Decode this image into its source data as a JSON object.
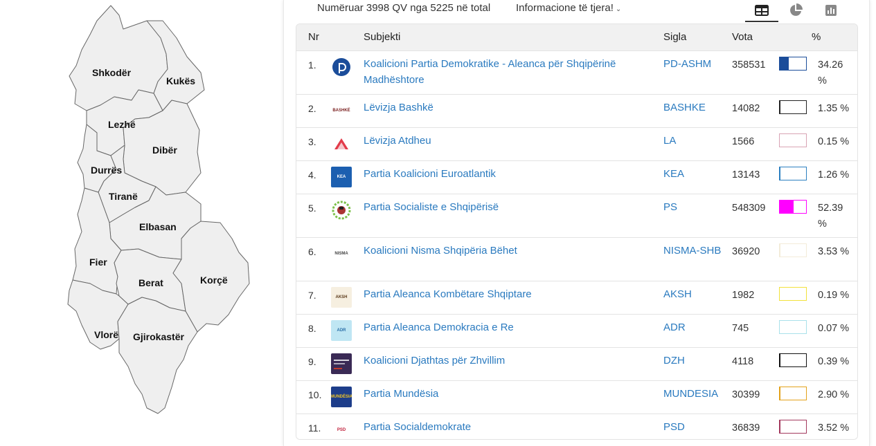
{
  "map": {
    "regions": [
      {
        "id": "shkoder",
        "label": "Shkodër"
      },
      {
        "id": "kukes",
        "label": "Kukës"
      },
      {
        "id": "lezhe",
        "label": "Lezhë"
      },
      {
        "id": "diber",
        "label": "Dibër"
      },
      {
        "id": "durres",
        "label": "Durrës"
      },
      {
        "id": "tirane",
        "label": "Tiranë"
      },
      {
        "id": "elbasan",
        "label": "Elbasan"
      },
      {
        "id": "fier",
        "label": "Fier"
      },
      {
        "id": "berat",
        "label": "Berat"
      },
      {
        "id": "korce",
        "label": "Korçë"
      },
      {
        "id": "vlore",
        "label": "Vlorë"
      },
      {
        "id": "gjirokaster",
        "label": "Gjirokastër"
      }
    ]
  },
  "header": {
    "counted_text": "Numëruar 3998 QV nga 5225 në total",
    "more_info_label": "Informacione të tjera!",
    "view_tabs": [
      {
        "icon": "table-icon",
        "active": true
      },
      {
        "icon": "pie-chart-icon",
        "active": false
      },
      {
        "icon": "bar-chart-icon",
        "active": false
      }
    ]
  },
  "table": {
    "columns": {
      "nr": "Nr",
      "subject": "Subjekti",
      "sigla": "Sigla",
      "votes": "Vota",
      "percent": "%"
    },
    "rows": [
      {
        "nr": "1.",
        "name": "Koalicioni Partia Demokratike - Aleanca për Shqipërinë Madhështore",
        "sigla": "PD-ASHM",
        "votes": "358531",
        "percent": "34.26 %",
        "share": 34.26,
        "color": "#1b4d9a",
        "logo": "pd-logo-icon"
      },
      {
        "nr": "2.",
        "name": "Lëvizja Bashkë",
        "sigla": "BASHKE",
        "votes": "14082",
        "percent": "1.35 %",
        "share": 1.35,
        "color": "#222222",
        "logo": "bashke-logo-icon",
        "logo_text": "BASHKË"
      },
      {
        "nr": "3.",
        "name": "Lëvizja Atdheu",
        "sigla": "LA",
        "votes": "1566",
        "percent": "0.15 %",
        "share": 0.15,
        "color": "#d9a3b4",
        "logo": "la-logo-icon"
      },
      {
        "nr": "4.",
        "name": "Partia Koalicioni Euroatlantik",
        "sigla": "KEA",
        "votes": "13143",
        "percent": "1.26 %",
        "share": 1.26,
        "color": "#2b7fc0",
        "logo": "kea-logo-icon",
        "logo_text": "KEA"
      },
      {
        "nr": "5.",
        "name": "Partia Socialiste e Shqipërisë",
        "sigla": "PS",
        "votes": "548309",
        "percent": "52.39 %",
        "share": 52.39,
        "color": "#ff00ff",
        "logo": "ps-logo-icon"
      },
      {
        "nr": "6.",
        "name": "Koalicioni Nisma Shqipëria Bëhet",
        "sigla": "NISMA-SHB",
        "votes": "36920",
        "percent": "3.53 %",
        "share": 3.53,
        "color": "#f3ecd9",
        "logo": "nisma-logo-icon",
        "logo_text": "NISMA"
      },
      {
        "nr": "7.",
        "name": "Partia Aleanca Kombëtare Shqiptare",
        "sigla": "AKSH",
        "votes": "1982",
        "percent": "0.19 %",
        "share": 0.19,
        "color": "#f2e13a",
        "logo": "aksh-logo-icon",
        "logo_text": "AKSH"
      },
      {
        "nr": "8.",
        "name": "Partia Aleanca Demokracia e Re",
        "sigla": "ADR",
        "votes": "745",
        "percent": "0.07 %",
        "share": 0.07,
        "color": "#a9e1ea",
        "logo": "adr-logo-icon",
        "logo_text": "ADR"
      },
      {
        "nr": "9.",
        "name": "Koalicioni Djathtas për Zhvillim",
        "sigla": "DZH",
        "votes": "4118",
        "percent": "0.39 %",
        "share": 0.39,
        "color": "#111111",
        "logo": "dzh-logo-icon"
      },
      {
        "nr": "10.",
        "name": "Partia Mundësia",
        "sigla": "MUNDESIA",
        "votes": "30399",
        "percent": "2.90 %",
        "share": 2.9,
        "color": "#e3a21a",
        "logo": "mundesia-logo-icon",
        "logo_text": "MUNDËSIA"
      },
      {
        "nr": "11.",
        "name": "Partia Socialdemokrate",
        "sigla": "PSD",
        "votes": "36839",
        "percent": "3.52 %",
        "share": 3.52,
        "color": "#a3385d",
        "logo": "psd-logo-icon",
        "logo_text": "PSD"
      }
    ]
  }
}
